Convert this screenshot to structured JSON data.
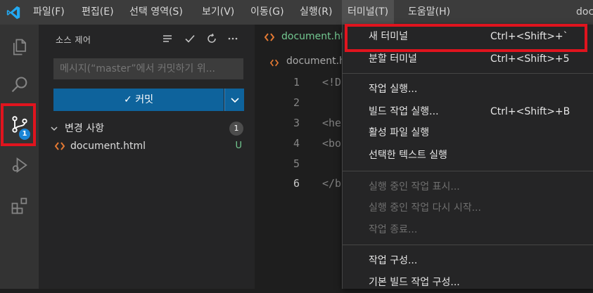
{
  "menubar": {
    "items": [
      "파일(F)",
      "편집(E)",
      "선택 영역(S)",
      "보기(V)",
      "이동(G)",
      "실행(R)",
      "터미널(T)",
      "도움말(H)"
    ],
    "window_title": "doc"
  },
  "sidebar": {
    "title": "소스 제어",
    "commit_placeholder": "메시지(“master”에서 커밋하기 위...",
    "commit_label": "✓ 커밋",
    "changes_label": "변경 사항",
    "changes_count": "1",
    "files": [
      {
        "name": "document.html",
        "status": "U"
      }
    ],
    "source_control_badge": "1"
  },
  "editor": {
    "tab_label": "document.ht",
    "breadcrumb": "document.h",
    "line_numbers": [
      "1",
      "2",
      "3",
      "4",
      "5",
      "6"
    ],
    "lines": [
      "<!D",
      "",
      "<he",
      "<bo",
      "",
      "</b"
    ]
  },
  "terminal_menu": {
    "items": [
      {
        "label": "새 터미널",
        "shortcut": "Ctrl+<Shift>+`",
        "enabled": true
      },
      {
        "label": "분할 터미널",
        "shortcut": "Ctrl+<Shift>+5",
        "enabled": true
      },
      {
        "label": "작업 실행...",
        "shortcut": "",
        "enabled": true
      },
      {
        "label": "빌드 작업 실행...",
        "shortcut": "Ctrl+<Shift>+B",
        "enabled": true
      },
      {
        "label": "활성 파일 실행",
        "shortcut": "",
        "enabled": true
      },
      {
        "label": "선택한 텍스트 실행",
        "shortcut": "",
        "enabled": true
      },
      {
        "label": "실행 중인 작업 표시...",
        "shortcut": "",
        "enabled": false
      },
      {
        "label": "실행 중인 작업 다시 시작...",
        "shortcut": "",
        "enabled": false
      },
      {
        "label": "작업 종료...",
        "shortcut": "",
        "enabled": false
      },
      {
        "label": "작업 구성...",
        "shortcut": "",
        "enabled": true
      },
      {
        "label": "기본 빌드 작업 구성...",
        "shortcut": "",
        "enabled": true
      }
    ]
  },
  "colors": {
    "accent": "#0e639c",
    "highlight": "#e0141e",
    "untracked": "#73c991",
    "badge": "#1a85d6"
  }
}
